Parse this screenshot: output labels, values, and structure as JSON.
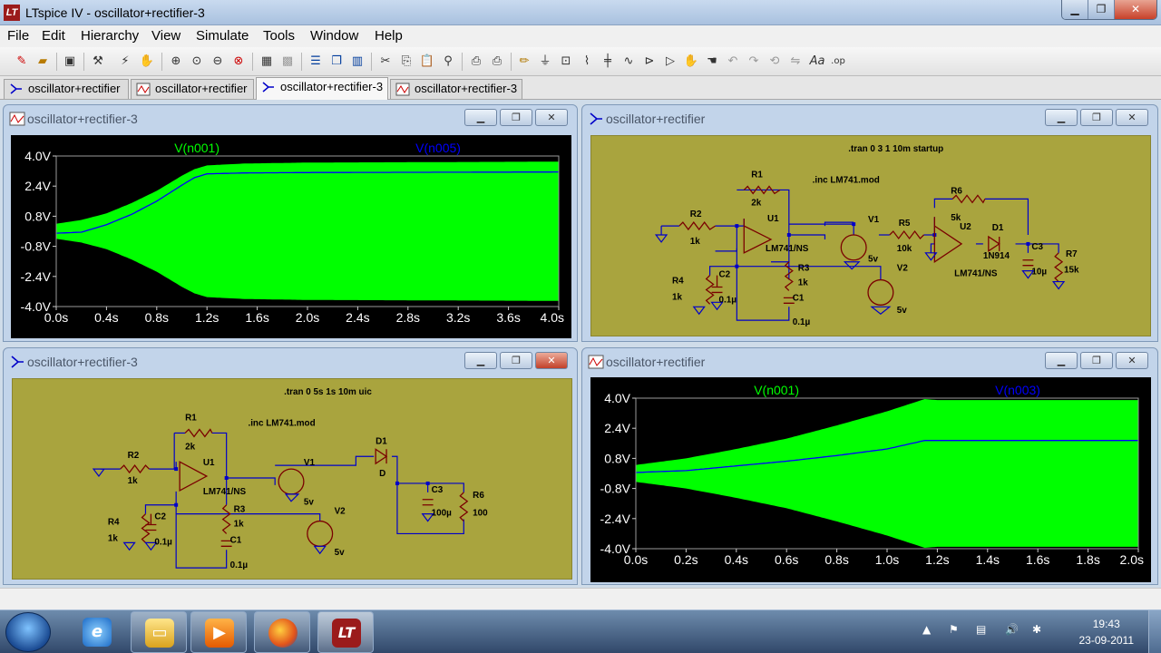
{
  "window": {
    "title": "LTspice IV - oscillator+rectifier-3",
    "min": "▁",
    "max": "❐",
    "close": "✕"
  },
  "menu": [
    "File",
    "Edit",
    "Hierarchy",
    "View",
    "Simulate",
    "Tools",
    "Window",
    "Help"
  ],
  "tabs": [
    {
      "label": "oscillator+rectifier",
      "kind": "schematic"
    },
    {
      "label": "oscillator+rectifier",
      "kind": "waveform"
    },
    {
      "label": "oscillator+rectifier-3",
      "kind": "schematic",
      "active": true
    },
    {
      "label": "oscillator+rectifier-3",
      "kind": "waveform"
    }
  ],
  "panes": {
    "tl": {
      "title": "oscillator+rectifier-3"
    },
    "tr": {
      "title": "oscillator+rectifier"
    },
    "bl": {
      "title": "oscillator+rectifier-3"
    },
    "br": {
      "title": "oscillator+rectifier"
    }
  },
  "chart_data": [
    {
      "type": "area",
      "series": [
        {
          "name": "V(n001)",
          "color": "#00ff00"
        },
        {
          "name": "V(n005)",
          "color": "#0000ff"
        }
      ],
      "yticks": [
        "4.0V",
        "2.4V",
        "0.8V",
        "-0.8V",
        "-2.4V",
        "-4.0V"
      ],
      "xticks": [
        "0.0s",
        "0.4s",
        "0.8s",
        "1.2s",
        "1.6s",
        "2.0s",
        "2.4s",
        "2.8s",
        "3.2s",
        "3.6s",
        "4.0s"
      ],
      "xlim": [
        0,
        4
      ],
      "ylim": [
        -4,
        4
      ],
      "env_t": [
        0,
        0.2,
        0.4,
        0.6,
        0.8,
        1.0,
        1.1,
        1.2,
        1.5,
        2.0,
        4.0
      ],
      "env_v": [
        0.4,
        0.6,
        0.95,
        1.5,
        2.15,
        2.95,
        3.3,
        3.5,
        3.6,
        3.65,
        3.7
      ],
      "line_t": [
        0,
        0.2,
        0.4,
        0.6,
        0.8,
        1.0,
        1.1,
        1.2,
        1.5,
        2.0,
        4.0
      ],
      "line_v": [
        -0.1,
        -0.05,
        0.35,
        0.9,
        1.6,
        2.45,
        2.85,
        3.05,
        3.1,
        3.12,
        3.15
      ]
    },
    {
      "type": "area",
      "series": [
        {
          "name": "V(n001)",
          "color": "#00ff00"
        },
        {
          "name": "V(n003)",
          "color": "#0000ff"
        }
      ],
      "yticks": [
        "4.0V",
        "2.4V",
        "0.8V",
        "-0.8V",
        "-2.4V",
        "-4.0V"
      ],
      "xticks": [
        "0.0s",
        "0.2s",
        "0.4s",
        "0.6s",
        "0.8s",
        "1.0s",
        "1.2s",
        "1.4s",
        "1.6s",
        "1.8s",
        "2.0s"
      ],
      "xlim": [
        0,
        2
      ],
      "ylim": [
        -4,
        4
      ],
      "env_t": [
        0,
        0.2,
        0.4,
        0.6,
        0.8,
        1.0,
        1.15,
        1.2,
        2.0
      ],
      "env_v": [
        0.45,
        0.8,
        1.3,
        1.85,
        2.55,
        3.3,
        3.95,
        3.9,
        3.9
      ],
      "line_t": [
        0,
        0.2,
        0.4,
        0.6,
        0.8,
        1.0,
        1.15,
        1.2,
        2.0
      ],
      "line_v": [
        0.05,
        0.15,
        0.4,
        0.65,
        0.95,
        1.3,
        1.75,
        1.75,
        1.75
      ]
    }
  ],
  "sch1": {
    "directive_tran": ".tran 0 3 1 10m startup",
    "directive_inc": ".inc LM741.mod",
    "R1": "R1",
    "R1v": "2k",
    "R2": "R2",
    "R2v": "1k",
    "R3": "R3",
    "R3v": "1k",
    "R4": "R4",
    "R4v": "1k",
    "R5": "R5",
    "R5v": "10k",
    "R6": "R6",
    "R6v": "5k",
    "R7": "R7",
    "R7v": "15k",
    "C1": "C1",
    "C1v": "0.1µ",
    "C2": "C2",
    "C2v": "0.1µ",
    "C3": "C3",
    "C3v": "10µ",
    "U1": "U1",
    "U1v": "LM741/NS",
    "U2": "U2",
    "U2v": "LM741/NS",
    "V1": "V1",
    "V1v": "5v",
    "V2": "V2",
    "V2v": "5v",
    "D1": "D1",
    "D1v": "1N914"
  },
  "sch2": {
    "directive_tran": ".tran 0 5s 1s 10m uic",
    "directive_inc": ".inc LM741.mod",
    "R1": "R1",
    "R1v": "2k",
    "R2": "R2",
    "R2v": "1k",
    "R3": "R3",
    "R3v": "1k",
    "R4": "R4",
    "R4v": "1k",
    "R6": "R6",
    "R6v": "100",
    "C1": "C1",
    "C1v": "0.1µ",
    "C2": "C2",
    "C2v": "0.1µ",
    "C3": "C3",
    "C3v": "100µ",
    "U1": "U1",
    "U1v": "LM741/NS",
    "V1": "V1",
    "V1v": "5v",
    "V2": "V2",
    "V2v": "5v",
    "D1": "D1",
    "D1v": "D"
  },
  "taskbar": {
    "time": "19:43",
    "date": "23-09-2011"
  },
  "colors": {
    "trace": "#00ff00",
    "line": "#0000ff",
    "schem_bg": "#a9a43e",
    "wire": "#0000c8",
    "comp": "#7a0000"
  }
}
